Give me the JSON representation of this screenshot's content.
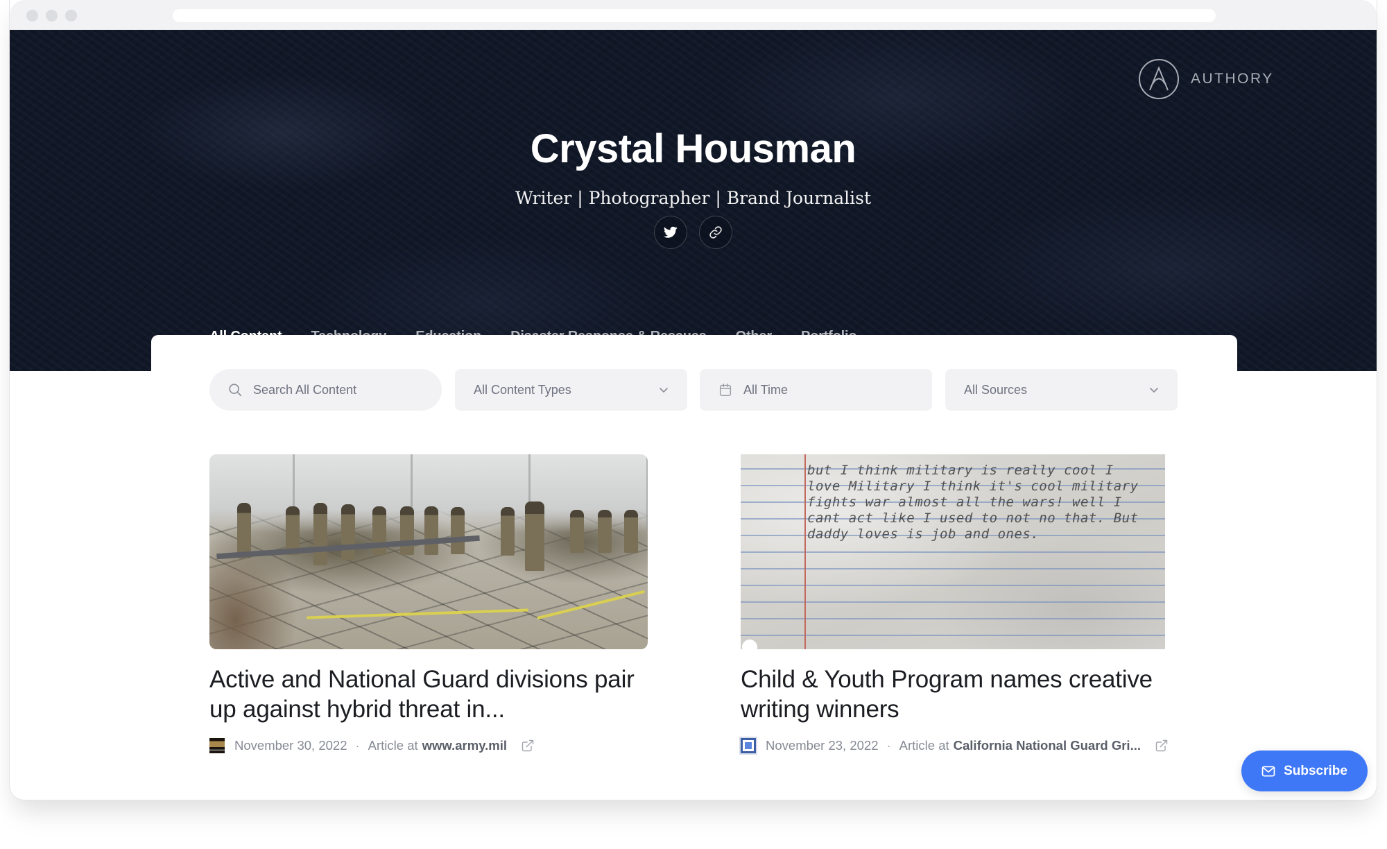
{
  "profile": {
    "name": "Crystal Housman",
    "tagline": "Writer | Photographer | Brand Journalist"
  },
  "brand": {
    "name": "AUTHORY",
    "logo_icon": "authory-logo-icon"
  },
  "social": [
    {
      "icon": "twitter-icon",
      "label": "Twitter"
    },
    {
      "icon": "link-icon",
      "label": "Website"
    }
  ],
  "tabs": [
    {
      "label": "All Content",
      "active": true
    },
    {
      "label": "Technology",
      "active": false
    },
    {
      "label": "Education",
      "active": false
    },
    {
      "label": "Disaster Response & Rescues",
      "active": false
    },
    {
      "label": "Other",
      "active": false
    },
    {
      "label": "Portfolio",
      "active": false
    }
  ],
  "filters": {
    "search_placeholder": "Search All Content",
    "search_value": "",
    "content_types": "All Content Types",
    "time": "All Time",
    "sources": "All Sources"
  },
  "articles": [
    {
      "title": "Active and National Guard divisions pair up against hybrid threat in...",
      "date": "November 30, 2022",
      "type_prefix": "Article at",
      "source": "www.army.mil",
      "thumbnail": "soldiers-in-tent-photo"
    },
    {
      "title": "Child & Youth Program names creative writing winners",
      "date": "November 23, 2022",
      "type_prefix": "Article at",
      "source": "California National Guard Gri...",
      "thumbnail": "handwritten-note-photo",
      "thumbnail_text": "but I think military is really cool I love Military I think it's cool military fights war almost all the wars! well I cant act like I used to not no that. But daddy loves is job and ones."
    }
  ],
  "meta_separator": "·",
  "subscribe": {
    "label": "Subscribe",
    "icon": "mail-icon"
  },
  "colors": {
    "accent": "#3f78f6",
    "hero_bg": "#101727",
    "filter_bg": "#f2f2f4",
    "title_text": "#1b1d22",
    "muted_text": "#868a94"
  }
}
